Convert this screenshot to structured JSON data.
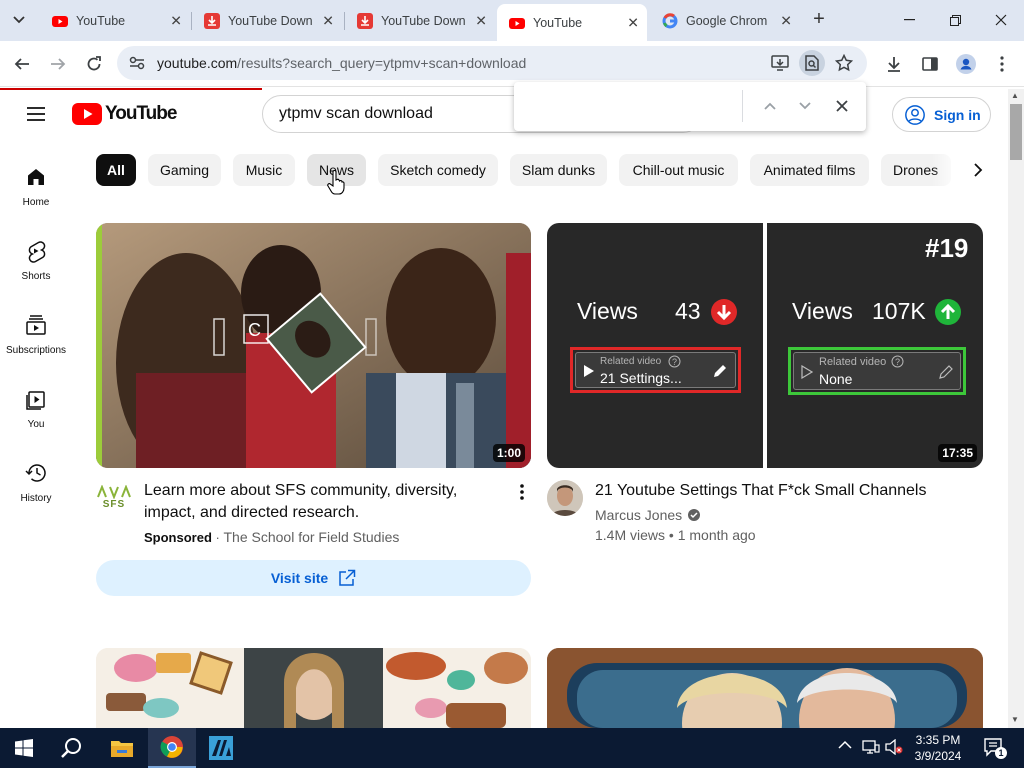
{
  "browser": {
    "tabs": [
      {
        "title": "YouTube",
        "favicon": "youtube-icon",
        "active": false
      },
      {
        "title": "YouTube Down",
        "favicon": "download-icon",
        "active": false
      },
      {
        "title": "YouTube Down",
        "favicon": "download-icon",
        "active": false
      },
      {
        "title": "YouTube",
        "favicon": "youtube-icon",
        "active": true
      },
      {
        "title": "Google Chrom",
        "favicon": "google-icon",
        "active": false
      }
    ],
    "url_host": "youtube.com",
    "url_path": "/results?search_query=ytpmv+scan+download"
  },
  "youtube": {
    "logo_text": "YouTube",
    "search_query": "ytpmv scan download",
    "signin_label": "Sign in",
    "nav": [
      {
        "label": "Home",
        "icon": "home-icon"
      },
      {
        "label": "Shorts",
        "icon": "shorts-icon"
      },
      {
        "label": "Subscriptions",
        "icon": "subscriptions-icon"
      },
      {
        "label": "You",
        "icon": "you-icon"
      },
      {
        "label": "History",
        "icon": "history-icon"
      }
    ],
    "chips": [
      "All",
      "Gaming",
      "Music",
      "News",
      "Sketch comedy",
      "Slam dunks",
      "Chill-out music",
      "Animated films",
      "Drones"
    ],
    "ad": {
      "title": "Learn more about SFS community, diversity, impact, and directed research.",
      "sponsored_label": "Sponsored",
      "advertiser": "The School for Field Studies",
      "logo_text": "SFS",
      "duration": "1:00",
      "overlay_letter": "C",
      "visit_label": "Visit site"
    },
    "video": {
      "title": "21 Youtube Settings That F*ck Small Channels",
      "channel": "Marcus Jones",
      "views": "1.4M views",
      "age": "1 month ago",
      "duration": "17:35",
      "thumb_left": {
        "views_label": "Views",
        "views_value": "43",
        "related_label": "Related video",
        "related_value": "21 Settings..."
      },
      "thumb_right": {
        "rank": "#19",
        "views_label": "Views",
        "views_value": "107K",
        "related_label": "Related video",
        "related_value": "None"
      }
    }
  },
  "taskbar": {
    "time": "3:35 PM",
    "date": "3/9/2024",
    "notification_count": "1"
  },
  "colors": {
    "yt_red": "#ff0000",
    "link_blue": "#065fd4",
    "taskbar": "#0b1a33"
  }
}
